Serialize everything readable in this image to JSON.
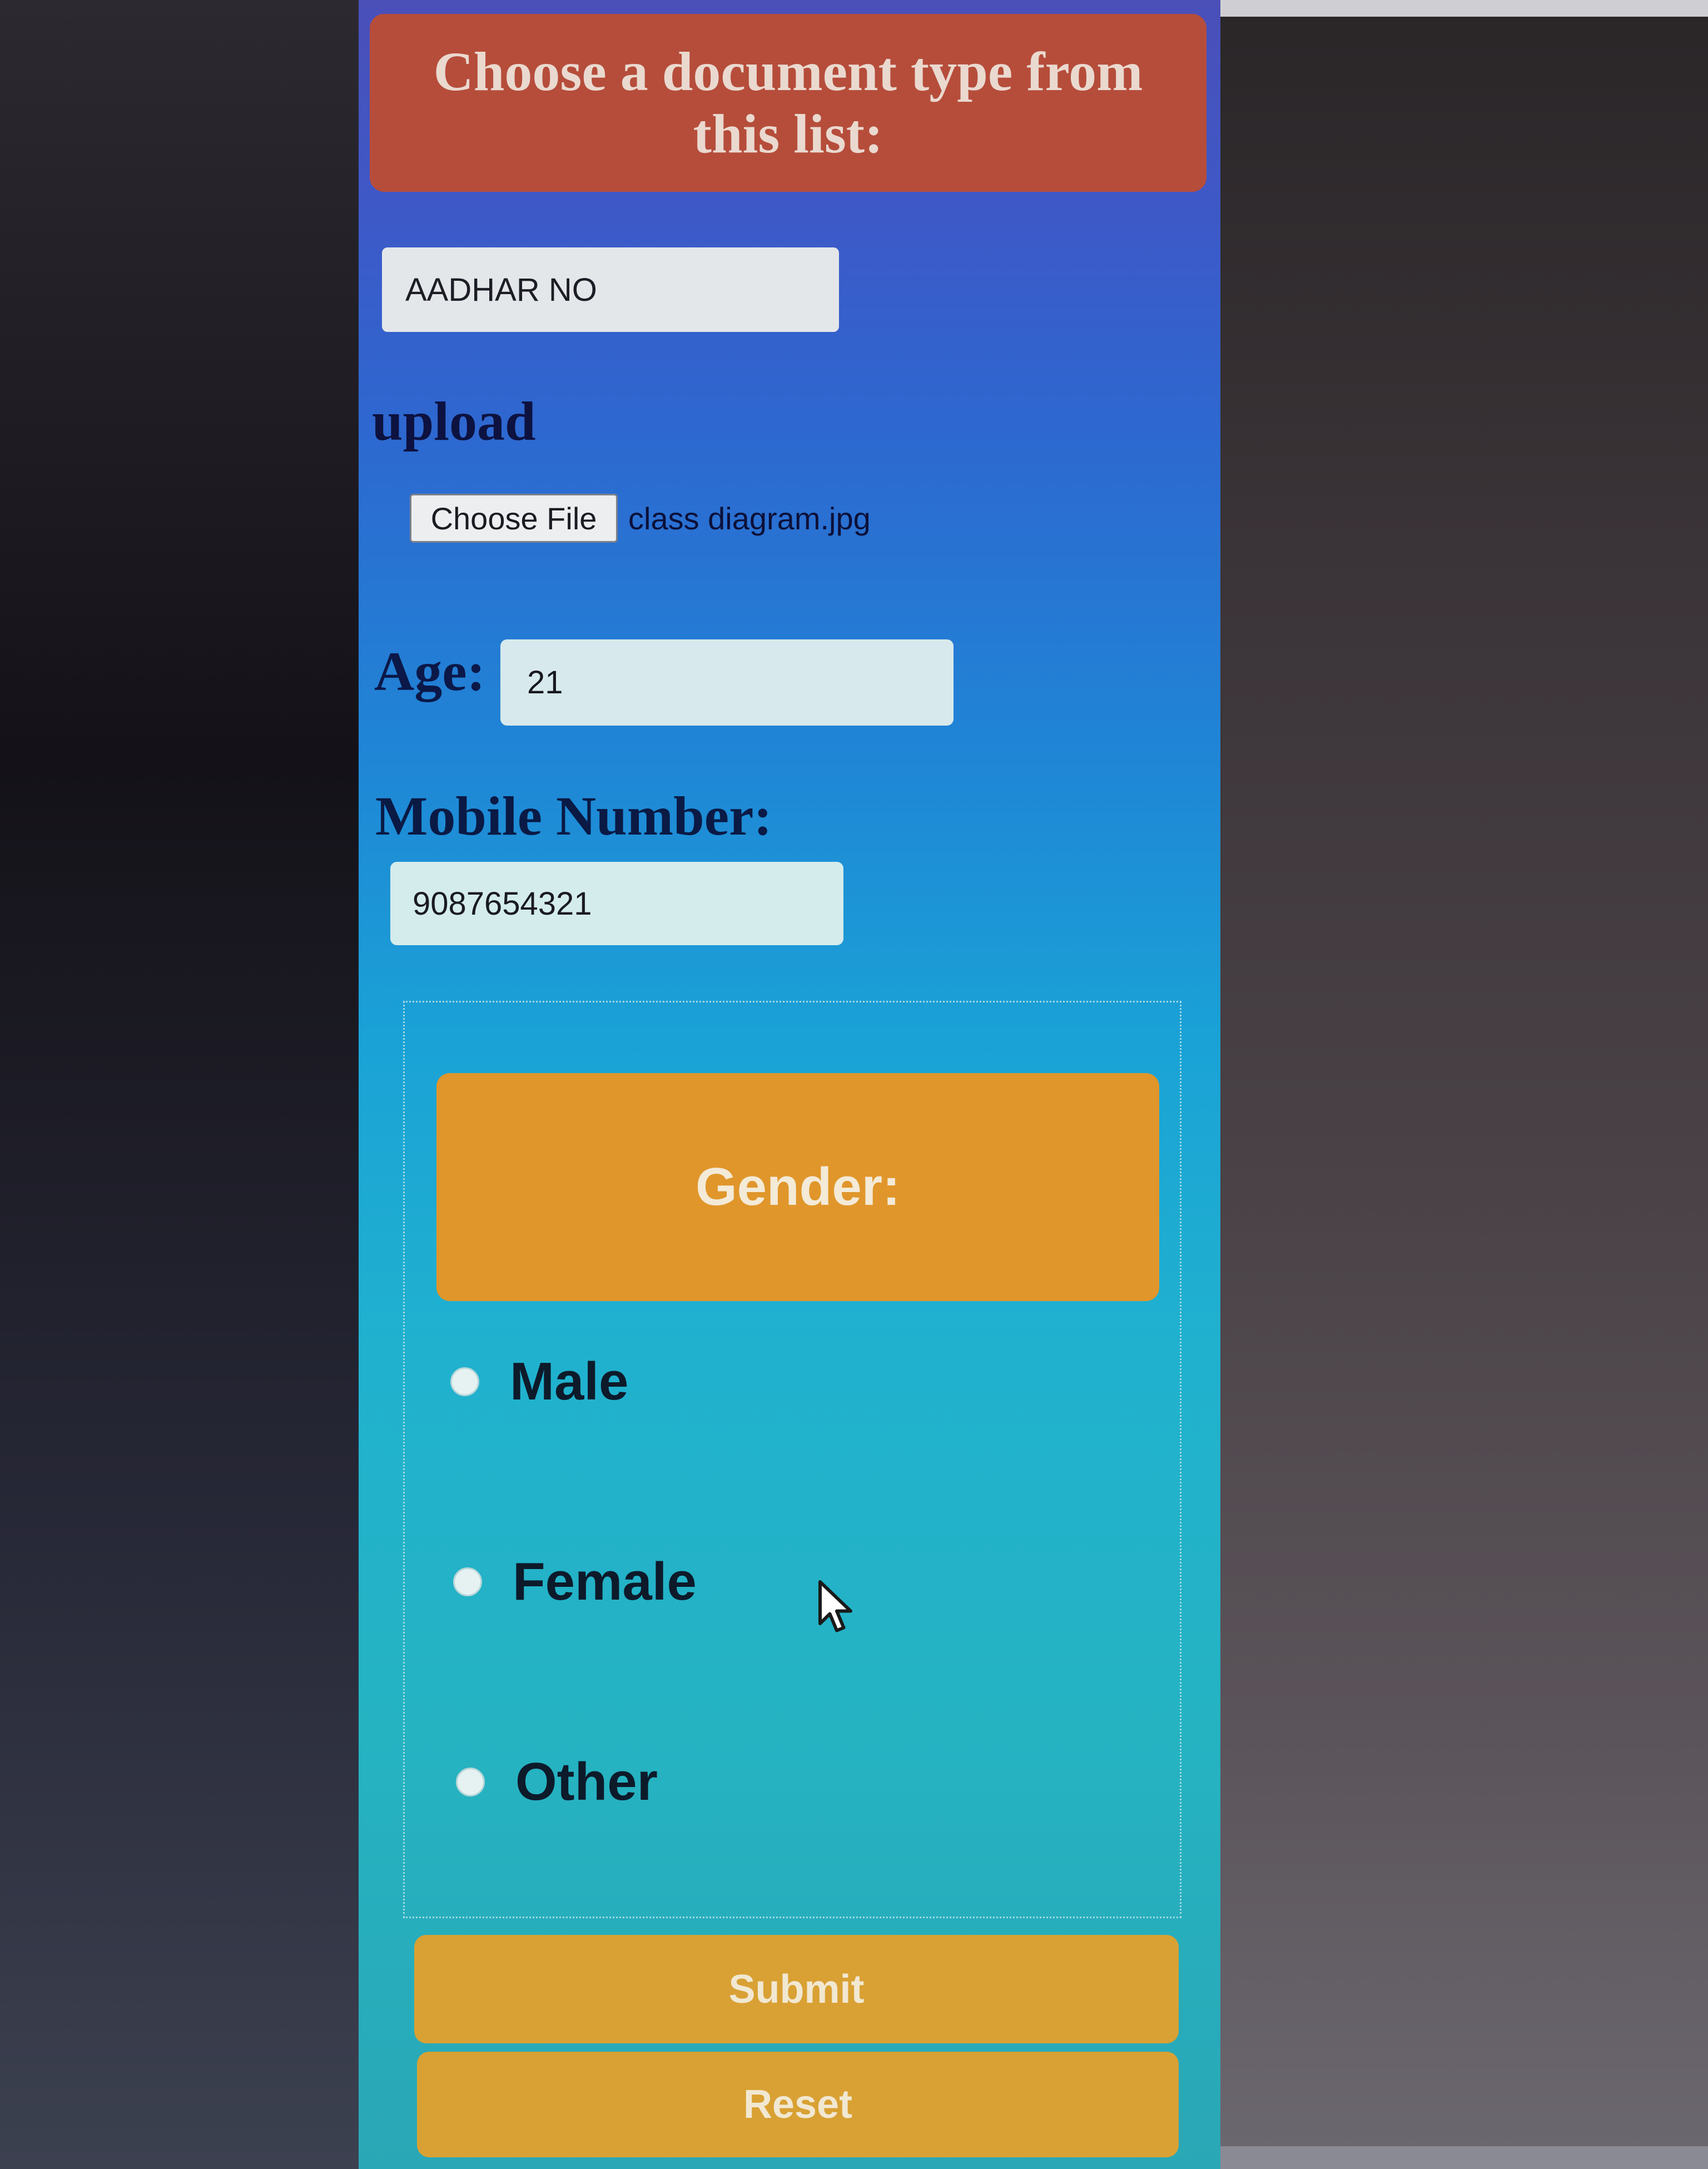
{
  "form": {
    "title": "Choose a document type from this list:",
    "document_type": {
      "selected": "AADHAR NO"
    },
    "upload": {
      "label": "upload",
      "button_label": "Choose File",
      "file_name": "class diagram.jpg"
    },
    "age": {
      "label": "Age:",
      "value": "21"
    },
    "mobile": {
      "label": "Mobile Number:",
      "value": "9087654321"
    },
    "gender": {
      "header": "Gender:",
      "options": [
        {
          "label": "Male"
        },
        {
          "label": "Female"
        },
        {
          "label": "Other"
        }
      ]
    },
    "buttons": {
      "submit_label": "Submit",
      "reset_label": "Reset"
    }
  },
  "colors": {
    "title_bg": "#b64d3b",
    "gender_header_bg": "#e0962a",
    "button_bg": "#d9a134",
    "panel_top": "#4b4fb8",
    "panel_bottom": "#2aa7b6"
  },
  "icons": {
    "cursor": "mouse-pointer-icon"
  }
}
